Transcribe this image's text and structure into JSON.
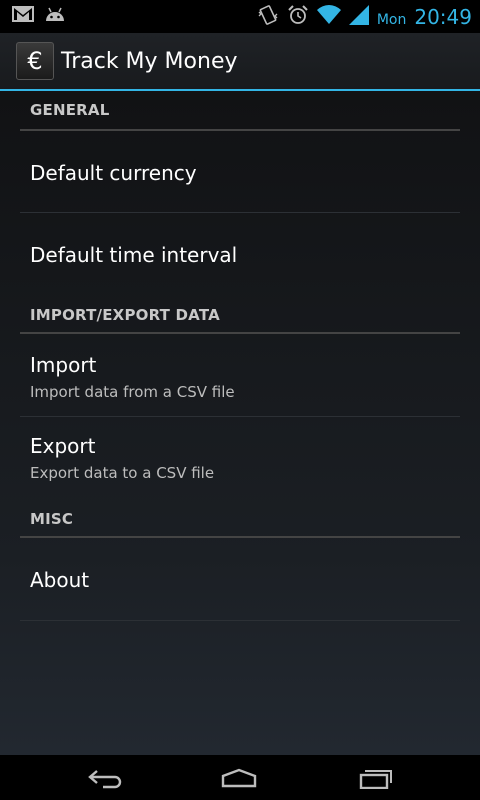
{
  "status_bar": {
    "day": "Mon",
    "time": "20:49",
    "icons": [
      "gmail-icon",
      "android-icon",
      "vibrate-icon",
      "alarm-icon",
      "wifi-icon",
      "signal-icon"
    ]
  },
  "action_bar": {
    "icon_glyph": "€",
    "title": "Track My Money"
  },
  "sections": [
    {
      "header": "GENERAL",
      "items": [
        {
          "title": "Default currency",
          "summary": ""
        },
        {
          "title": "Default time interval",
          "summary": ""
        }
      ]
    },
    {
      "header": "IMPORT/EXPORT DATA",
      "items": [
        {
          "title": "Import",
          "summary": "Import data from a CSV file"
        },
        {
          "title": "Export",
          "summary": "Export data to a CSV file"
        }
      ]
    },
    {
      "header": "MISC",
      "items": [
        {
          "title": "About",
          "summary": ""
        }
      ]
    }
  ],
  "nav_bar": {
    "buttons": [
      "back-icon",
      "home-icon",
      "recents-icon"
    ]
  },
  "colors": {
    "accent": "#33b5e5",
    "background": "#000000"
  }
}
